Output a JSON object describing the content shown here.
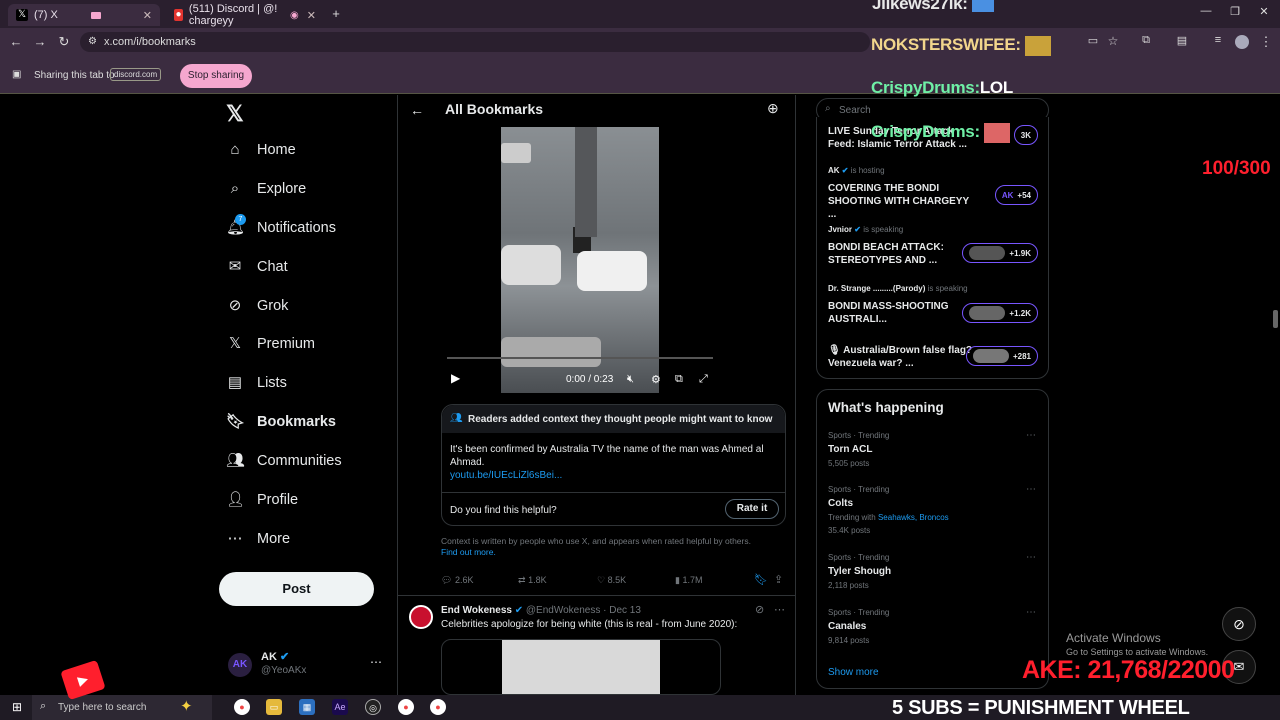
{
  "tabs": [
    {
      "label": "(7) X",
      "icon": "x-logo-icon"
    },
    {
      "label": "(511) Discord | @! chargeyy",
      "icon": "discord-icon"
    }
  ],
  "address": {
    "url": "x.com/i/bookmarks"
  },
  "sharing": {
    "text": "Sharing this tab to",
    "target": "discord.com",
    "stop_label": "Stop sharing"
  },
  "overlay": {
    "chat": [
      {
        "user": "Jllkews27lk:",
        "msg": ""
      },
      {
        "user": "NOKSTERSWIFEE:",
        "msg": ""
      },
      {
        "user": "CrispyDrums:",
        "msg": "LOL"
      },
      {
        "user": "CrispyDrums:",
        "msg": ""
      }
    ],
    "counter": "100/300",
    "goal": "AKE: 21,768/22000",
    "punishment": "5 SUBS = PUNISHMENT WHEEL",
    "activate_title": "Activate Windows",
    "activate_sub": "Go to Settings to activate Windows."
  },
  "sidebar": {
    "items": [
      {
        "label": "Home",
        "icon": "home-icon"
      },
      {
        "label": "Explore",
        "icon": "search-icon"
      },
      {
        "label": "Notifications",
        "icon": "bell-icon",
        "badge": "7"
      },
      {
        "label": "Chat",
        "icon": "mail-icon"
      },
      {
        "label": "Grok",
        "icon": "grok-icon"
      },
      {
        "label": "Premium",
        "icon": "x-logo-icon"
      },
      {
        "label": "Lists",
        "icon": "list-icon"
      },
      {
        "label": "Bookmarks",
        "icon": "bookmark-icon"
      },
      {
        "label": "Communities",
        "icon": "communities-icon"
      },
      {
        "label": "Profile",
        "icon": "person-icon"
      },
      {
        "label": "More",
        "icon": "more-circle-icon"
      }
    ],
    "post_label": "Post",
    "account": {
      "name": "AK",
      "handle": "@YeoAKx"
    }
  },
  "header": {
    "title": "All Bookmarks"
  },
  "video": {
    "time": "0:00 / 0:23"
  },
  "community_note": {
    "title": "Readers added context they thought people might want to know",
    "body": "It's been confirmed by Australia TV the name of the man was Ahmed al Ahmad.",
    "link": "youtu.be/IUEcLiZl6sBei...",
    "question": "Do you find this helpful?",
    "rate_label": "Rate it",
    "footer": "Context is written by people who use X, and appears when rated helpful by others.",
    "find_more": "Find out more."
  },
  "actions": {
    "replies": "2.6K",
    "reposts": "1.8K",
    "likes": "8.5K",
    "views": "1.7M"
  },
  "post2": {
    "name": "End Wokeness",
    "handle": "@EndWokeness",
    "date": "· Dec 13",
    "text": "Celebrities apologize for being white (this is real - from June 2020):"
  },
  "search": {
    "placeholder": "Search"
  },
  "spaces": [
    {
      "title": "LIVE Sunday Terror Attack Feed: Islamic Terror Attack ...",
      "pill": "3K",
      "host": "",
      "status": ""
    },
    {
      "host": "AK",
      "status": "is hosting",
      "title": "COVERING THE BONDI SHOOTING WITH CHARGEYY ...",
      "pill": "+54"
    },
    {
      "host": "Jvnior",
      "status": "is speaking",
      "title": "BONDI BEACH ATTACK: STEREOTYPES AND ...",
      "pill": "+1.9K"
    },
    {
      "host": "Dr. Strange .........(Parody)",
      "status": "is speaking",
      "title": "BONDI MASS-SHOOTING AUSTRALI...",
      "pill": "+1.2K"
    },
    {
      "host": "",
      "status": "",
      "title": "Australia/Brown false flag? Venezuela war? ...",
      "pill": "+281"
    }
  ],
  "happening": {
    "title": "What's happening",
    "trends": [
      {
        "category": "Sports · Trending",
        "name": "Torn ACL",
        "count": "5,505 posts",
        "with": ""
      },
      {
        "category": "Sports · Trending",
        "name": "Colts",
        "count": "35.4K posts",
        "with": "Trending with",
        "with_links": "Seahawks, Broncos"
      },
      {
        "category": "Sports · Trending",
        "name": "Tyler Shough",
        "count": "2,118 posts",
        "with": ""
      },
      {
        "category": "Sports · Trending",
        "name": "Canales",
        "count": "9,814 posts",
        "with": ""
      }
    ],
    "show_more": "Show more"
  },
  "taskbar": {
    "search_placeholder": "Type here to search"
  },
  "colors": {
    "accent": "#1d9bf0",
    "spaces": "#7856ff",
    "goal_red": "#ff1f2d",
    "share_pink": "#f5a7cf"
  }
}
